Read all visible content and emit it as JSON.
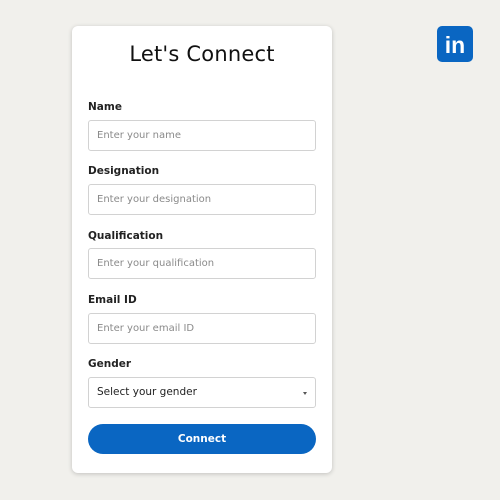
{
  "form": {
    "title": "Let's Connect",
    "fields": [
      {
        "label": "Name",
        "placeholder": "Enter your name"
      },
      {
        "label": "Designation",
        "placeholder": "Enter your designation"
      },
      {
        "label": "Qualification",
        "placeholder": "Enter your qualification"
      },
      {
        "label": "Email ID",
        "placeholder": "Enter your email ID"
      }
    ],
    "gender": {
      "label": "Gender",
      "selected": "Select your gender"
    },
    "submit_label": "Connect"
  },
  "logo": {
    "name": "linkedin-icon",
    "text": "in",
    "color": "#0a66c2"
  },
  "colors": {
    "accent": "#0a66c2",
    "background": "#f1f0ec"
  }
}
